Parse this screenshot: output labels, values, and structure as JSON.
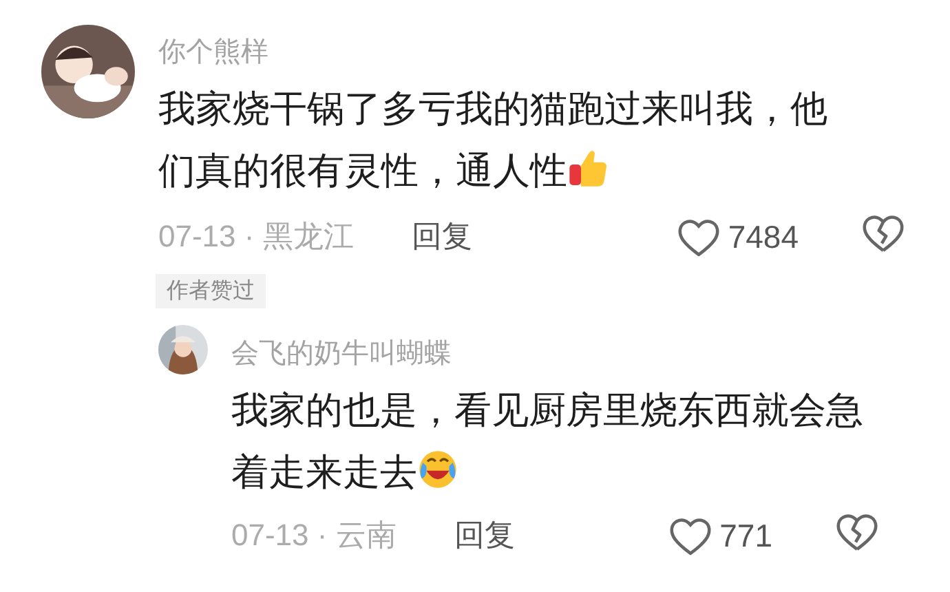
{
  "comments": [
    {
      "author": "你个熊样",
      "text": "我家烧干锅了多亏我的猫跑过来叫我，他们真的很有灵性，通人性",
      "emoji": {
        "kind": "thumbs_up"
      },
      "meta": "07-13 · 黑龙江",
      "reply_label": "回复",
      "likes": "7484",
      "tag": "作者赞过",
      "replies": [
        {
          "author": "会飞的奶牛叫蝴蝶",
          "text": "我家的也是，看见厨房里烧东西就会急着走来走去",
          "emoji": {
            "kind": "laugh_cry"
          },
          "meta": "07-13 · 云南",
          "reply_label": "回复",
          "likes": "771"
        }
      ]
    }
  ]
}
